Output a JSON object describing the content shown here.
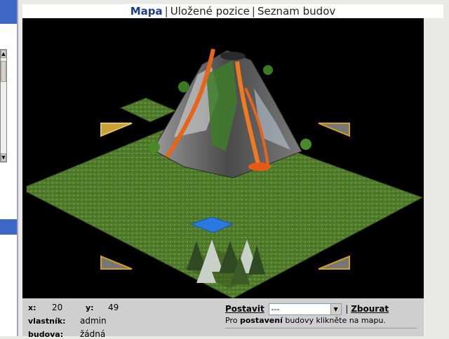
{
  "tabs": {
    "map": "Mapa",
    "saved": "Uložené pozice",
    "buildings": "Seznam budov"
  },
  "tile": {
    "x_label": "x:",
    "x_value": "20",
    "y_label": "y:",
    "y_value": "49",
    "owner_label": "vlastník:",
    "owner_value": "admin",
    "building_label": "budova:",
    "building_value": "žádná"
  },
  "build": {
    "build_link": "Postavit",
    "select_value": "---",
    "separator": "|",
    "demolish_link": "Zbourat",
    "hint_pre": "Pro ",
    "hint_bold": "postavení",
    "hint_post": " budovy klikněte na mapu."
  },
  "colors": {
    "grass": "#4f7a2b",
    "water": "#2a78e0",
    "arrow": "#d4a017",
    "volcano": "#5a5a5a",
    "lava": "#e8641a",
    "accent": "#1f3b8c"
  },
  "icons": [
    "scroll-up-icon",
    "scroll-down-icon",
    "nav-arrow-nw-icon",
    "nav-arrow-ne-icon",
    "nav-arrow-sw-icon",
    "nav-arrow-se-icon",
    "dropdown-arrow-icon"
  ]
}
